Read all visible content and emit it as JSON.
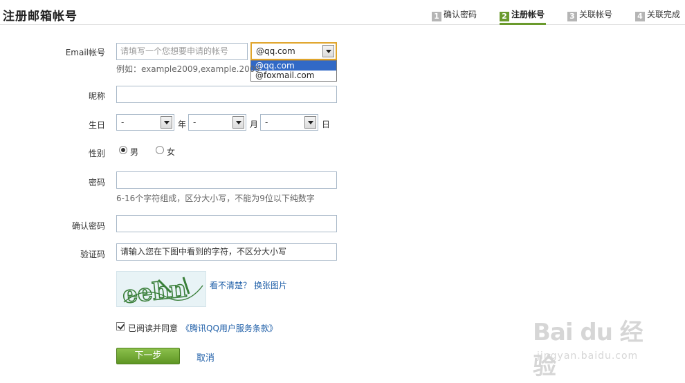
{
  "header": {
    "title": "注册邮箱帐号",
    "steps": [
      {
        "num": "1",
        "label": "确认密码",
        "active": false
      },
      {
        "num": "2",
        "label": "注册帐号",
        "active": true
      },
      {
        "num": "3",
        "label": "关联帐号",
        "active": false
      },
      {
        "num": "4",
        "label": "关联完成",
        "active": false
      }
    ]
  },
  "form": {
    "email": {
      "label": "Email帐号",
      "placeholder": "请填写一个您想要申请的帐号",
      "hint": "例如：example2009,example.2009",
      "domain_value": "@qq.com",
      "domain_options": [
        "@qq.com",
        "@foxmail.com"
      ]
    },
    "nickname": {
      "label": "昵称",
      "value": ""
    },
    "birthday": {
      "label": "生日",
      "year_value": "-",
      "year_unit": "年",
      "month_value": "-",
      "month_unit": "月",
      "day_value": "-",
      "day_unit": "日"
    },
    "gender": {
      "label": "性别",
      "male": "男",
      "female": "女",
      "selected": "male"
    },
    "password": {
      "label": "密码",
      "value": "",
      "hint": "6-16个字符组成，区分大小写，不能为9位以下纯数字"
    },
    "confirm_password": {
      "label": "确认密码",
      "value": ""
    },
    "captcha": {
      "label": "验证码",
      "placeholder": "请输入您在下图中看到的字符，不区分大小写",
      "cant_see": "看不清楚？",
      "refresh": "换张图片",
      "image_text": "eehn"
    },
    "agreement": {
      "checked": true,
      "text": "已阅读并同意",
      "link": "《腾讯QQ用户服务条款》"
    },
    "next_button": "下一步",
    "cancel_link": "取消"
  },
  "watermark": {
    "logo": "Bai du 经验",
    "url": "jingyan.baidu.com"
  },
  "colors": {
    "accent": "#6a9a2d",
    "link": "#1f5fa8",
    "focus": "#e0a52c",
    "selected": "#3169c6"
  }
}
